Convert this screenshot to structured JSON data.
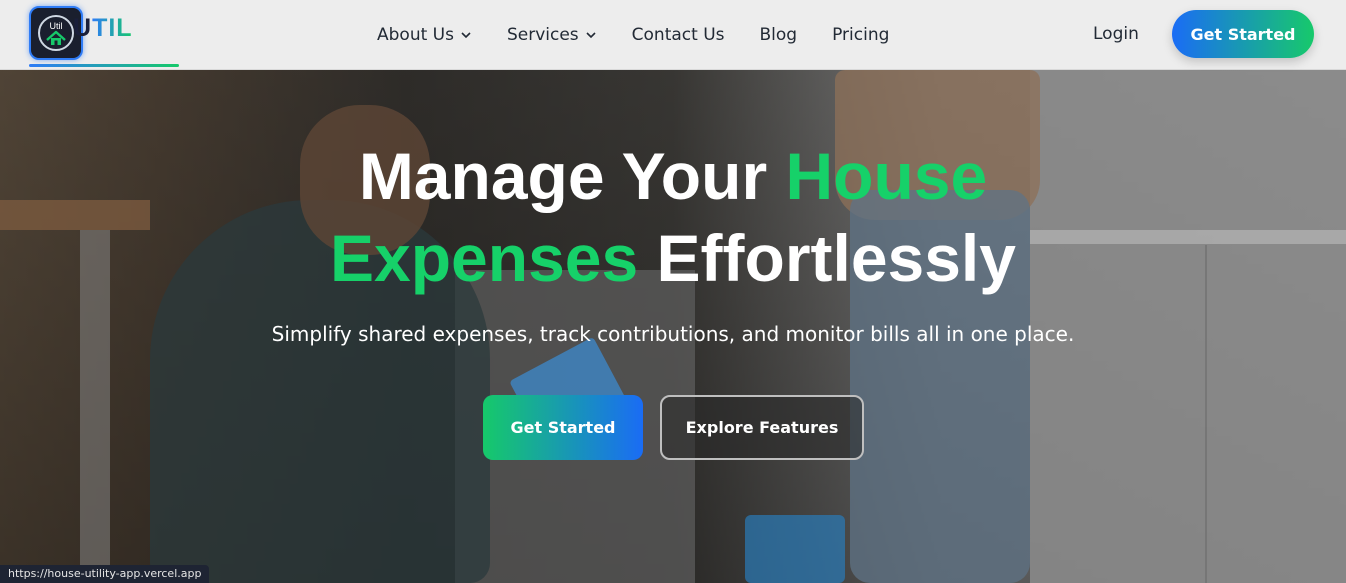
{
  "brand": {
    "logo_text": "Util",
    "name_prefix": "U",
    "name_suffix": "TIL"
  },
  "nav": {
    "items": [
      {
        "label": "About Us",
        "has_dropdown": true
      },
      {
        "label": "Services",
        "has_dropdown": true
      },
      {
        "label": "Contact Us",
        "has_dropdown": false
      },
      {
        "label": "Blog",
        "has_dropdown": false
      },
      {
        "label": "Pricing",
        "has_dropdown": false
      }
    ],
    "login_label": "Login",
    "cta_label": "Get Started"
  },
  "hero": {
    "title_line1_white": "Manage Your ",
    "title_line1_green": "House",
    "title_line2_green": "Expenses",
    "title_line2_white": " Effortlessly",
    "subtitle": "Simplify shared expenses, track contributions, and monitor bills all in one place.",
    "primary_button": "Get Started",
    "secondary_button": "Explore Features"
  },
  "status_bar": {
    "url": "https://house-utility-app.vercel.app"
  },
  "colors": {
    "accent_green": "#16d169",
    "accent_blue": "#1a6cf5",
    "nav_bg": "#ededed",
    "nav_text": "#222a35"
  },
  "icons": {
    "logo": "house-icon",
    "dropdown": "chevron-down-icon"
  }
}
